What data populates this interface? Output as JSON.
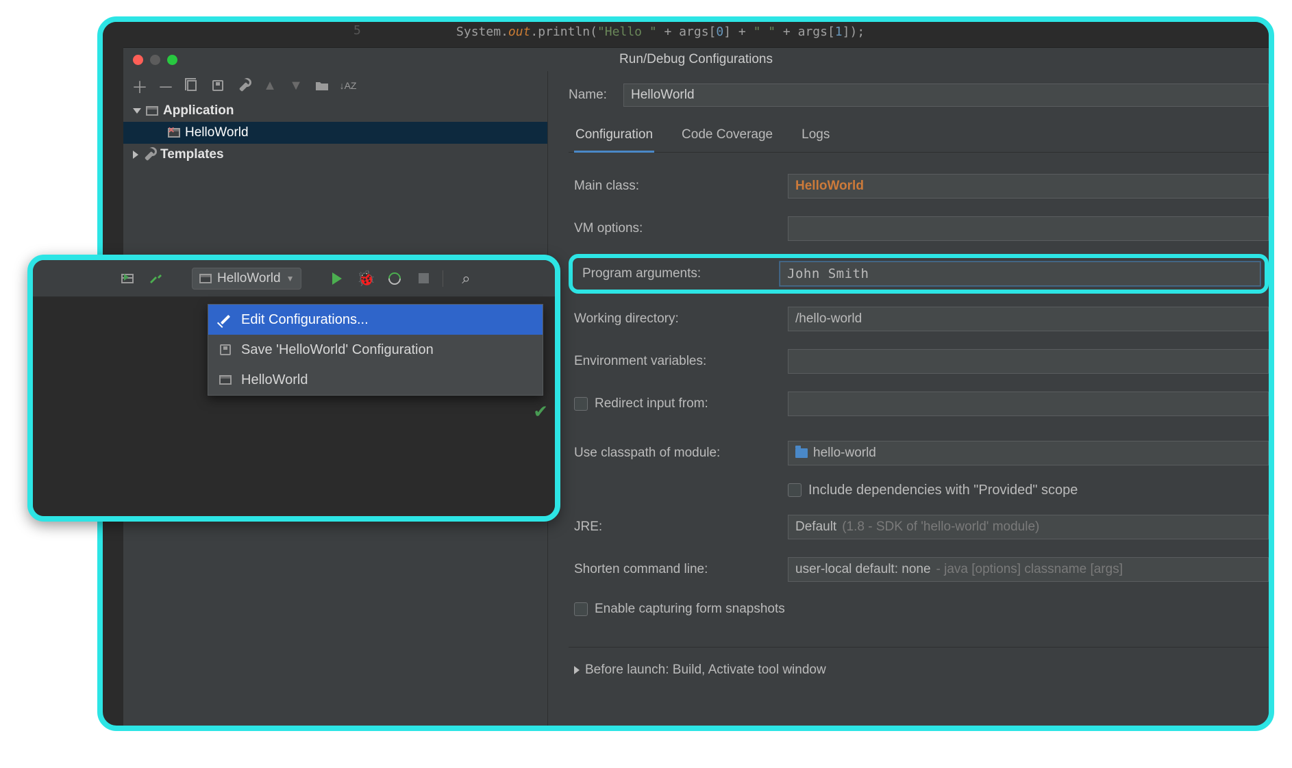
{
  "editor": {
    "line_no": "5",
    "code_html": "System.out.println(\"Hello \" + args[0] + \" \" + args[1]);"
  },
  "dialog": {
    "title": "Run/Debug Configurations",
    "toolbar": {
      "add": "+",
      "remove": "−"
    },
    "tree": {
      "application": "Application",
      "helloworld": "HelloWorld",
      "templates": "Templates"
    },
    "name_label": "Name:",
    "name_value": "HelloWorld",
    "tabs": [
      "Configuration",
      "Code Coverage",
      "Logs"
    ],
    "rows": {
      "main_class_label": "Main class:",
      "main_class_value": "HelloWorld",
      "vm_label": "VM options:",
      "args_label": "Program arguments:",
      "args_value": "John Smith",
      "wd_label": "Working directory:",
      "wd_value": "/hello-world",
      "env_label": "Environment variables:",
      "redirect_label": "Redirect input from:",
      "classpath_label": "Use classpath of module:",
      "classpath_value": "hello-world",
      "include_provided": "Include dependencies with \"Provided\" scope",
      "jre_label": "JRE:",
      "jre_value": "Default",
      "jre_dim": " (1.8 - SDK of 'hello-world' module)",
      "shorten_label": "Shorten command line:",
      "shorten_value": "user-local default: none",
      "shorten_dim": " - java [options] classname [args]",
      "snapshots": "Enable capturing form snapshots",
      "before_launch": "Before launch: Build, Activate tool window"
    }
  },
  "popup": {
    "combo": "HelloWorld",
    "dropdown": {
      "edit": "Edit Configurations...",
      "save": "Save 'HelloWorld' Configuration",
      "hw": "HelloWorld"
    }
  }
}
